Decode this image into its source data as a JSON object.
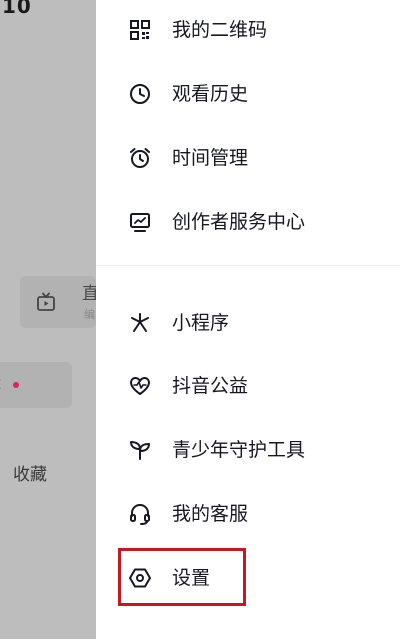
{
  "status_bar": {
    "time": "10"
  },
  "background": {
    "card_title": "直",
    "card_subtitle": "编",
    "dot_row_label": "t",
    "favorites_label": "收藏"
  },
  "drawer": {
    "items": [
      {
        "label": "我的二维码",
        "icon": "qr-code-icon"
      },
      {
        "label": "观看历史",
        "icon": "clock-icon"
      },
      {
        "label": "时间管理",
        "icon": "alarm-clock-icon"
      },
      {
        "label": "创作者服务中心",
        "icon": "monitor-chart-icon"
      },
      {
        "label": "小程序",
        "icon": "mini-program-icon"
      },
      {
        "label": "抖音公益",
        "icon": "heart-pulse-icon"
      },
      {
        "label": "青少年守护工具",
        "icon": "sprout-icon"
      },
      {
        "label": "我的客服",
        "icon": "headset-icon"
      },
      {
        "label": "设置",
        "icon": "settings-hexagon-icon"
      }
    ]
  },
  "colors": {
    "highlight_border": "#c4191f",
    "text": "#161823",
    "dimmed_background": "#bdbdbd",
    "badge_dot": "#e0245e"
  }
}
